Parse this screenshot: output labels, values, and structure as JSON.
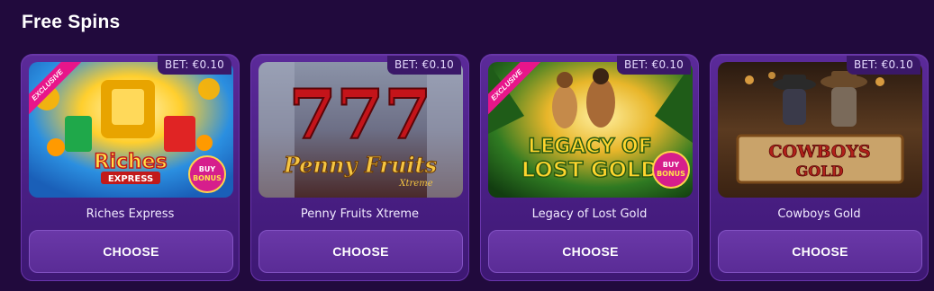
{
  "section": {
    "title": "Free Spins"
  },
  "cards": [
    {
      "name": "Riches Express",
      "bet": "BET: €0.10",
      "exclusive": "EXCLUSIVE",
      "art_title": "Riches",
      "art_subtitle": "EXPRESS",
      "bonus_line1": "BUY",
      "bonus_line2": "BONUS",
      "choose": "CHOOSE"
    },
    {
      "name": "Penny Fruits Xtreme",
      "bet": "BET: €0.10",
      "art_title": "Penny Fruits",
      "art_subtitle": "Xtreme",
      "art_sevens": "777",
      "choose": "CHOOSE"
    },
    {
      "name": "Legacy of Lost Gold",
      "bet": "BET: €0.10",
      "exclusive": "EXCLUSIVE",
      "art_title": "LEGACY OF",
      "art_subtitle": "LOST GOLD",
      "bonus_line1": "BUY",
      "bonus_line2": "BONUS",
      "choose": "CHOOSE"
    },
    {
      "name": "Cowboys Gold",
      "bet": "BET: €0.10",
      "art_title": "COWBOYS",
      "art_subtitle": "GOLD",
      "choose": "CHOOSE"
    }
  ],
  "colors": {
    "background": "#210a3d",
    "card": "#4a1f85",
    "button": "#5a2c96",
    "exclusive_ribbon": "#e8158a"
  }
}
